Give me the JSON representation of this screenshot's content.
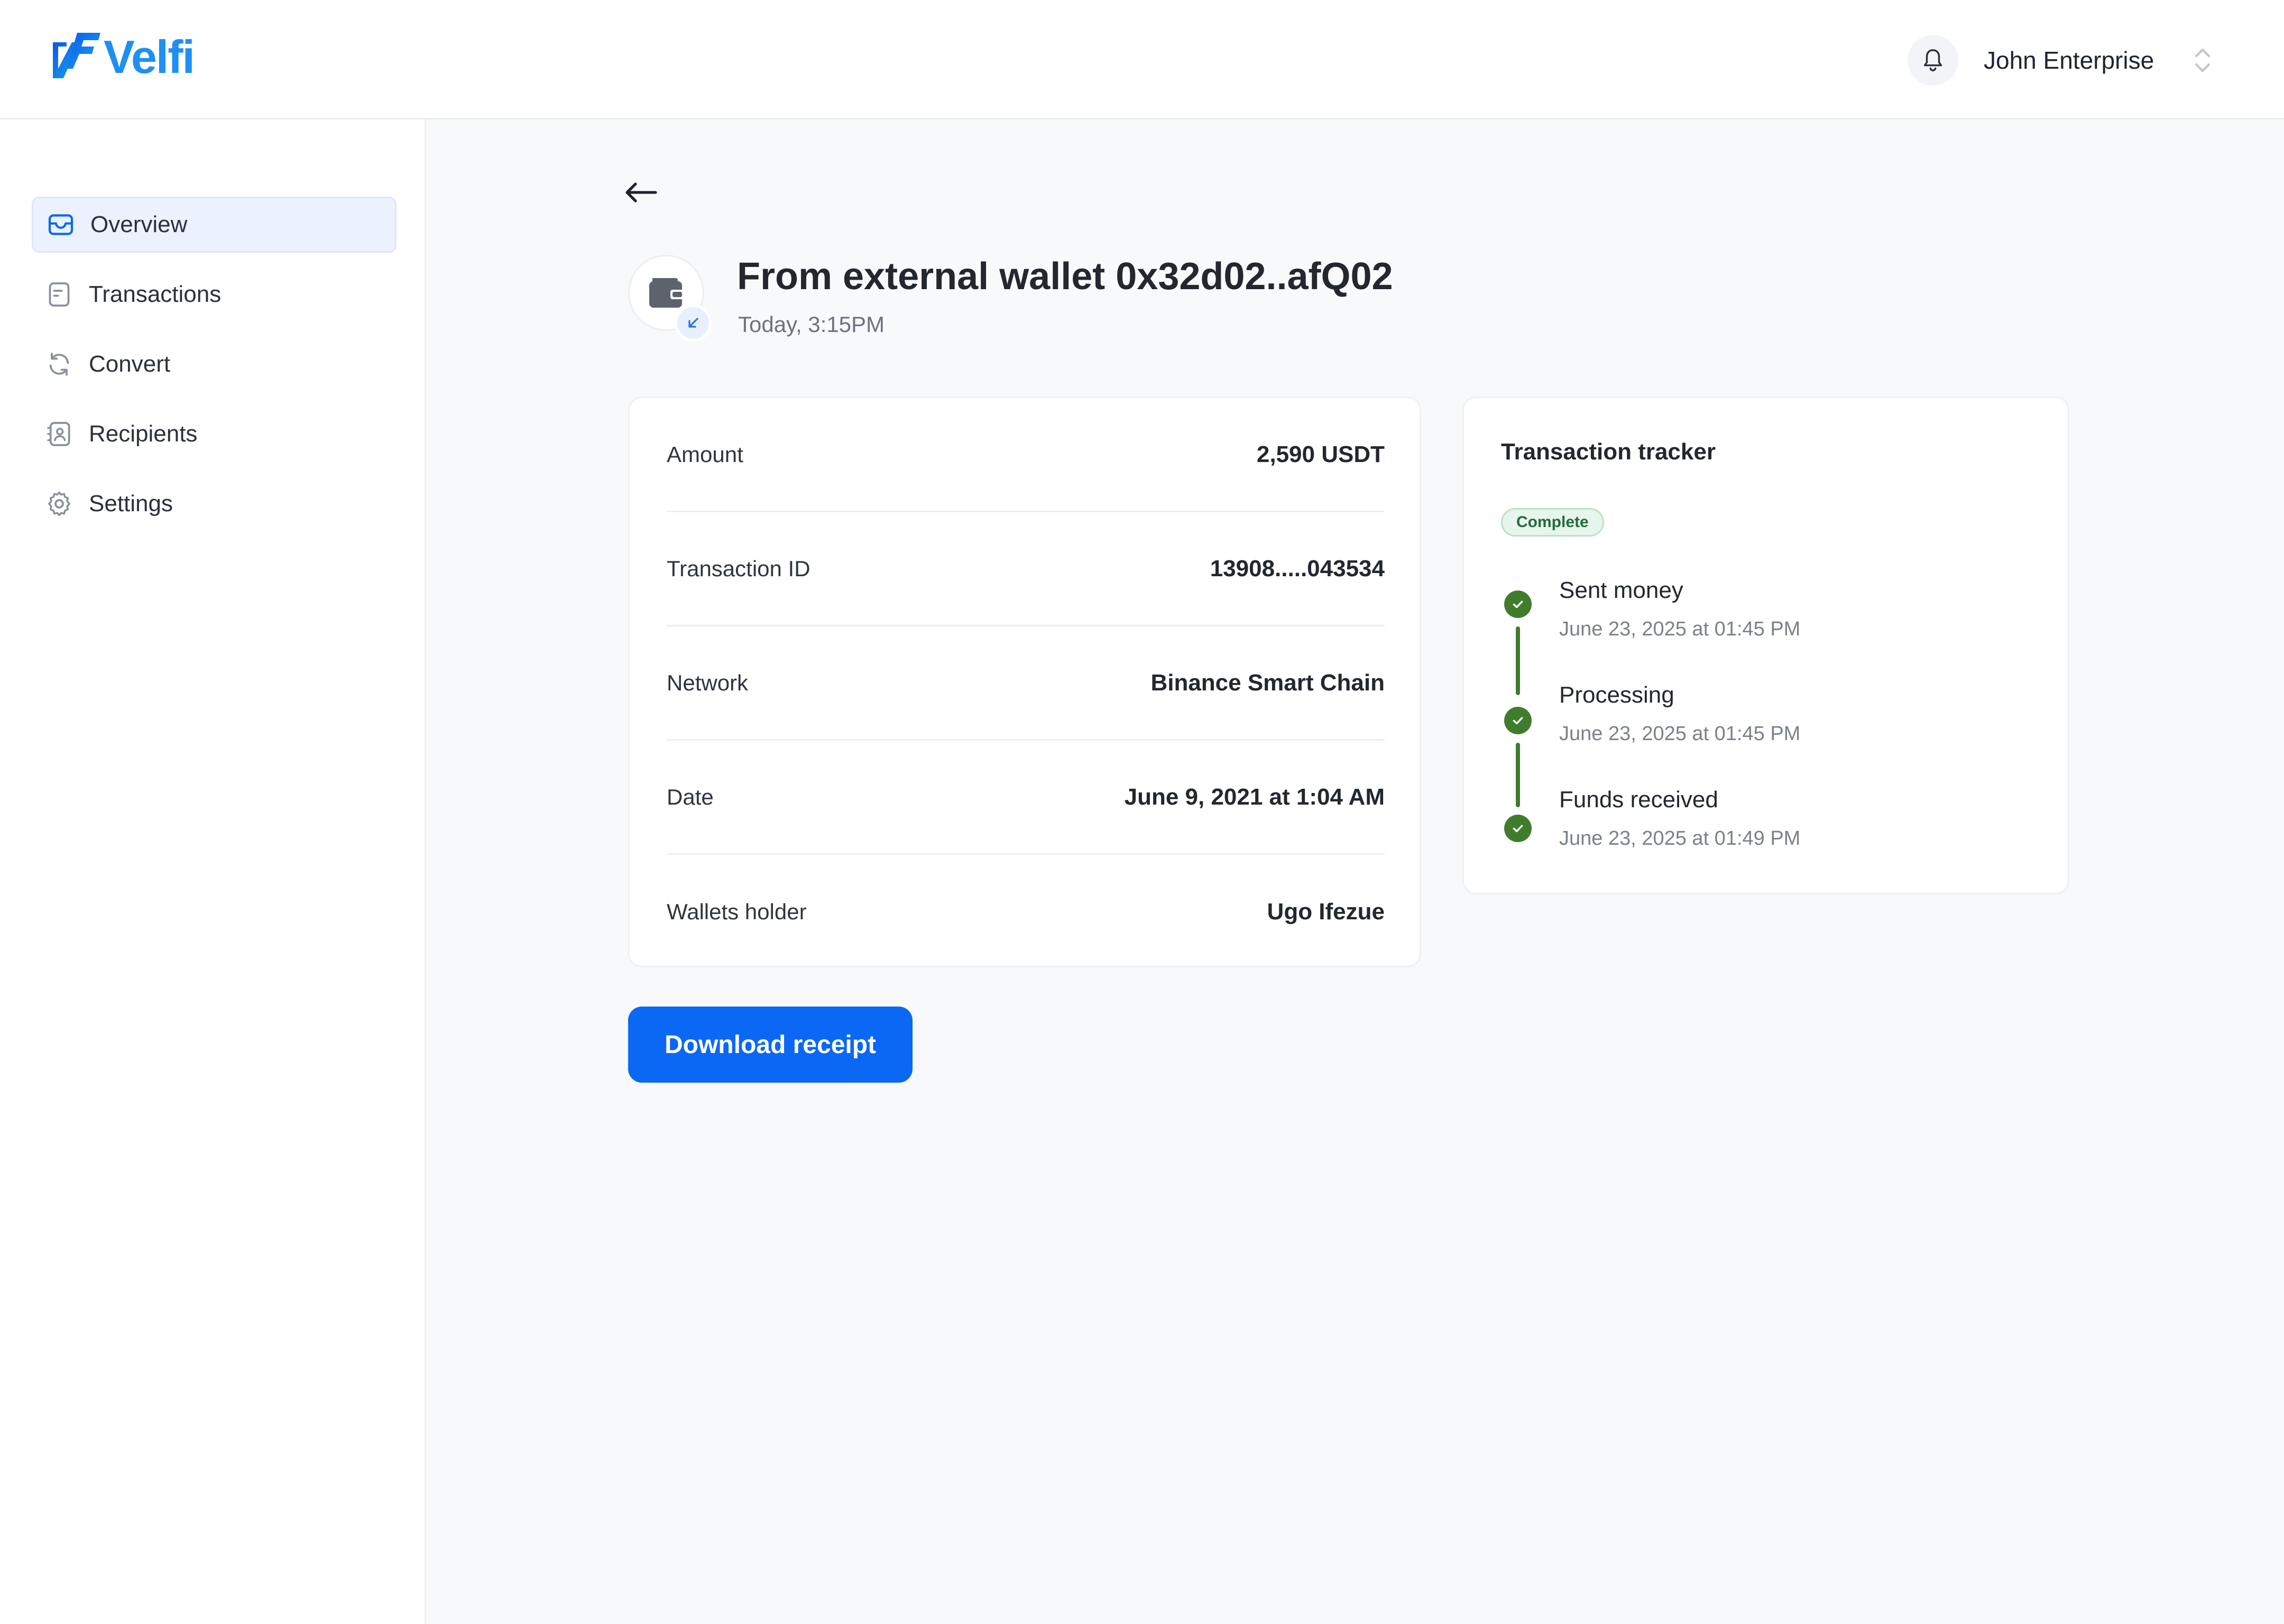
{
  "brand": {
    "name": "Velfi",
    "accent": "#1e8ff5"
  },
  "header": {
    "user_name": "John Enterprise",
    "icons": {
      "notifications": "bell-icon",
      "account_switch": "chevron-updown-icon"
    }
  },
  "sidebar": {
    "items": [
      {
        "label": "Overview",
        "icon": "inbox-icon",
        "active": true
      },
      {
        "label": "Transactions",
        "icon": "document-icon",
        "active": false
      },
      {
        "label": "Convert",
        "icon": "refresh-icon",
        "active": false
      },
      {
        "label": "Recipients",
        "icon": "contact-icon",
        "active": false
      },
      {
        "label": "Settings",
        "icon": "gear-icon",
        "active": false
      }
    ]
  },
  "transaction": {
    "title": "From external wallet 0x32d02..afQ02",
    "subtitle": "Today, 3:15PM",
    "icons": {
      "back": "arrow-left-icon",
      "type": "wallet-icon",
      "direction": "arrow-down-left-icon"
    },
    "details": [
      {
        "label": "Amount",
        "value": "2,590 USDT"
      },
      {
        "label": "Transaction ID",
        "value": "13908.....043534"
      },
      {
        "label": "Network",
        "value": "Binance Smart Chain"
      },
      {
        "label": "Date",
        "value": "June 9, 2021 at 1:04 AM"
      },
      {
        "label": "Wallets holder",
        "value": "Ugo Ifezue"
      }
    ]
  },
  "tracker": {
    "title": "Transaction tracker",
    "status": "Complete",
    "status_color": "#226b3c",
    "steps": [
      {
        "title": "Sent money",
        "time": "June 23, 2025 at 01:45 PM",
        "done": true
      },
      {
        "title": "Processing",
        "time": "June 23, 2025 at 01:45 PM",
        "done": true
      },
      {
        "title": "Funds received",
        "time": "June 23, 2025 at 01:49 PM",
        "done": true
      }
    ],
    "step_color": "#3f7d2c"
  },
  "actions": {
    "download_label": "Download receipt",
    "button_color": "#0b68f5"
  }
}
